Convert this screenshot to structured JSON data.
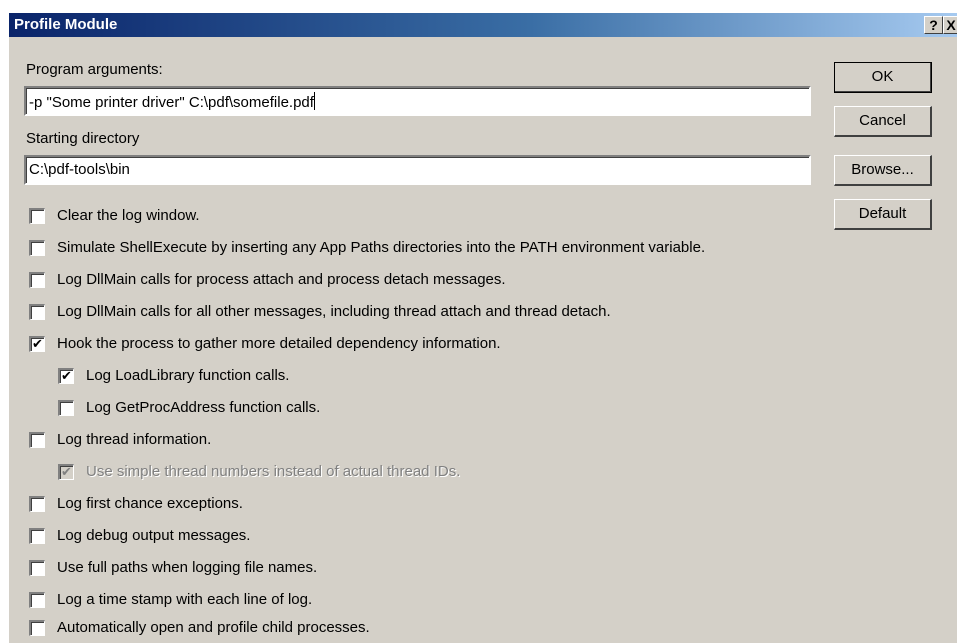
{
  "window": {
    "title": "Profile Module",
    "help_glyph": "?",
    "close_glyph": "X"
  },
  "program_arguments": {
    "label": "Program arguments:",
    "value": "-p \"Some printer driver\" C:\\pdf\\somefile.pdf"
  },
  "starting_directory": {
    "label": "Starting directory",
    "value": "C:\\pdf-tools\\bin"
  },
  "buttons": {
    "ok": "OK",
    "cancel": "Cancel",
    "browse": "Browse...",
    "default": "Default"
  },
  "options": [
    {
      "label": "Clear the log window.",
      "checked": false,
      "enabled": true
    },
    {
      "label": "Simulate ShellExecute by inserting any App Paths directories into the PATH environment variable.",
      "checked": false,
      "enabled": true
    },
    {
      "label": "Log DllMain calls for process attach and process detach messages.",
      "checked": false,
      "enabled": true
    },
    {
      "label": "Log DllMain calls for all other messages, including thread attach and thread detach.",
      "checked": false,
      "enabled": true
    },
    {
      "label": "Hook the process to gather more detailed dependency information.",
      "checked": true,
      "enabled": true
    },
    {
      "label": "Log LoadLibrary function calls.",
      "checked": true,
      "enabled": true
    },
    {
      "label": "Log GetProcAddress function calls.",
      "checked": false,
      "enabled": true
    },
    {
      "label": "Log thread information.",
      "checked": false,
      "enabled": true
    },
    {
      "label": "Use simple thread numbers instead of actual thread IDs.",
      "checked": true,
      "enabled": false
    },
    {
      "label": "Log first chance exceptions.",
      "checked": false,
      "enabled": true
    },
    {
      "label": "Log debug output messages.",
      "checked": false,
      "enabled": true
    },
    {
      "label": "Use full paths when logging file names.",
      "checked": false,
      "enabled": true
    },
    {
      "label": "Log a time stamp with each line of log.",
      "checked": false,
      "enabled": true
    },
    {
      "label": "Automatically open and profile child processes.",
      "checked": false,
      "enabled": true
    }
  ],
  "check_glyph": "✔"
}
